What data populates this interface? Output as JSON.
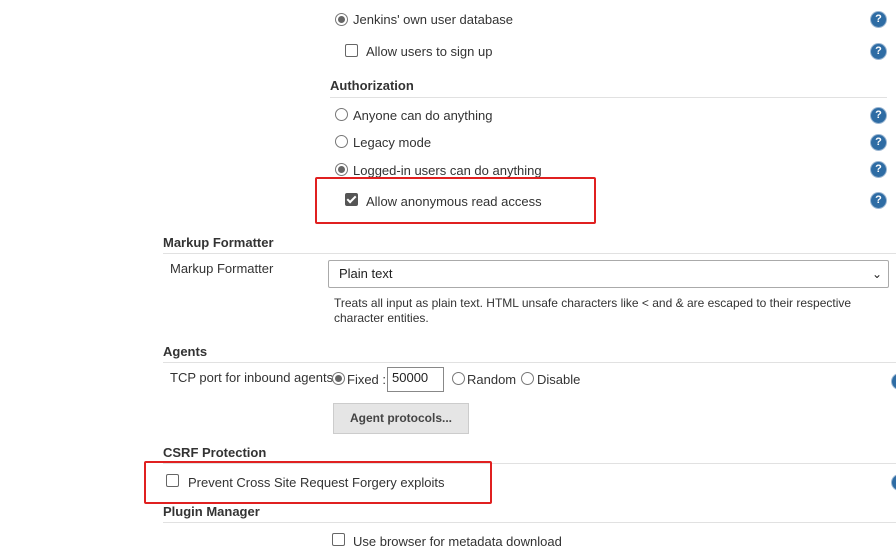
{
  "security_realm": {
    "jenkins_db_label": "Jenkins' own user database",
    "allow_signup_label": "Allow users to sign up"
  },
  "authorization": {
    "title": "Authorization",
    "options": [
      {
        "label": "Anyone can do anything",
        "selected": false
      },
      {
        "label": "Legacy mode",
        "selected": false
      },
      {
        "label": "Logged-in users can do anything",
        "selected": true
      }
    ],
    "anonymous_read_label": "Allow anonymous read access",
    "anonymous_read_checked": true
  },
  "markup_formatter": {
    "section_title": "Markup Formatter",
    "field_label": "Markup Formatter",
    "selected_value": "Plain text",
    "description": "Treats all input as plain text. HTML unsafe characters like < and & are escaped to their respective character entities."
  },
  "agents": {
    "section_title": "Agents",
    "tcp_label": "TCP port for inbound agents",
    "fixed_label": "Fixed :",
    "port_value": "50000",
    "random_label": "Random",
    "disable_label": "Disable",
    "protocols_button": "Agent protocols..."
  },
  "csrf": {
    "section_title": "CSRF Protection",
    "prevent_label": "Prevent Cross Site Request Forgery exploits",
    "prevent_checked": false
  },
  "plugin_manager": {
    "section_title": "Plugin Manager",
    "browser_metadata_label": "Use browser for metadata download"
  },
  "help_icon_glyph": "?",
  "colors": {
    "highlight": "#e02020",
    "help_icon": "#2e6ca4"
  }
}
